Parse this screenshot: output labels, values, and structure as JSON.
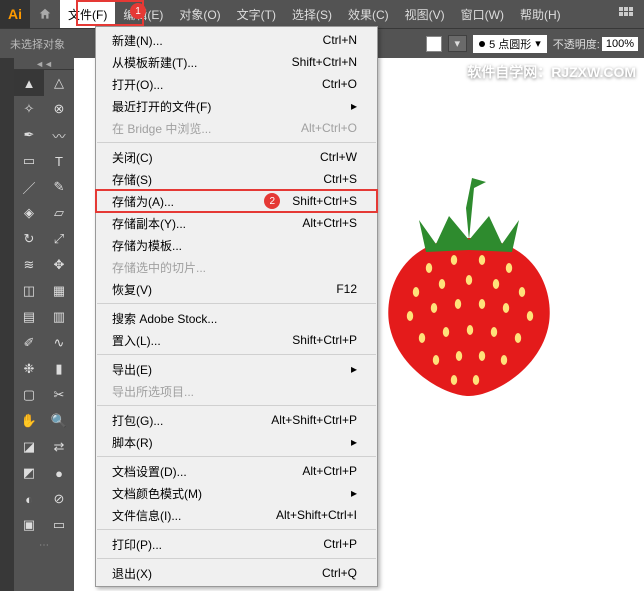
{
  "menubar": {
    "items": [
      "文件(F)",
      "编辑(E)",
      "对象(O)",
      "文字(T)",
      "选择(S)",
      "效果(C)",
      "视图(V)",
      "窗口(W)",
      "帮助(H)"
    ],
    "active_index": 0
  },
  "callouts": {
    "one": "1",
    "two": "2"
  },
  "options": {
    "noselect": "未选择对象",
    "stroke_style": "5 点圆形",
    "opacity_label": "不透明度:",
    "opacity_value": "100%"
  },
  "watermark": "软件自学网：RJZXW.COM",
  "dropdown": {
    "items": [
      {
        "label": "新建(N)...",
        "shortcut": "Ctrl+N"
      },
      {
        "label": "从模板新建(T)...",
        "shortcut": "Shift+Ctrl+N"
      },
      {
        "label": "打开(O)...",
        "shortcut": "Ctrl+O"
      },
      {
        "label": "最近打开的文件(F)",
        "submenu": true
      },
      {
        "label": "在 Bridge 中浏览...",
        "shortcut": "Alt+Ctrl+O",
        "disabled": true
      },
      {
        "sep": true
      },
      {
        "label": "关闭(C)",
        "shortcut": "Ctrl+W"
      },
      {
        "label": "存储(S)",
        "shortcut": "Ctrl+S"
      },
      {
        "label": "存储为(A)...",
        "shortcut": "Shift+Ctrl+S",
        "highlighted": true,
        "callout": true
      },
      {
        "label": "存储副本(Y)...",
        "shortcut": "Alt+Ctrl+S"
      },
      {
        "label": "存储为模板...",
        "shortcut": ""
      },
      {
        "label": "存储选中的切片...",
        "shortcut": "",
        "disabled": true
      },
      {
        "label": "恢复(V)",
        "shortcut": "F12"
      },
      {
        "sep": true
      },
      {
        "label": "搜索 Adobe Stock...",
        "shortcut": ""
      },
      {
        "label": "置入(L)...",
        "shortcut": "Shift+Ctrl+P"
      },
      {
        "sep": true
      },
      {
        "label": "导出(E)",
        "submenu": true
      },
      {
        "label": "导出所选项目...",
        "shortcut": "",
        "disabled": true
      },
      {
        "sep": true
      },
      {
        "label": "打包(G)...",
        "shortcut": "Alt+Shift+Ctrl+P"
      },
      {
        "label": "脚本(R)",
        "submenu": true
      },
      {
        "sep": true
      },
      {
        "label": "文档设置(D)...",
        "shortcut": "Alt+Ctrl+P"
      },
      {
        "label": "文档颜色模式(M)",
        "submenu": true
      },
      {
        "label": "文件信息(I)...",
        "shortcut": "Alt+Shift+Ctrl+I"
      },
      {
        "sep": true
      },
      {
        "label": "打印(P)...",
        "shortcut": "Ctrl+P"
      },
      {
        "sep": true
      },
      {
        "label": "退出(X)",
        "shortcut": "Ctrl+Q"
      }
    ]
  },
  "tools": [
    "selection",
    "direct-selection",
    "magic-wand",
    "lasso",
    "pen",
    "curvature",
    "rectangle",
    "type",
    "line",
    "paintbrush",
    "shaper",
    "eraser",
    "rotate",
    "scale",
    "width",
    "free-transform",
    "shape-builder",
    "perspective-grid",
    "mesh",
    "gradient",
    "eyedropper",
    "blend",
    "symbol-sprayer",
    "column-graph",
    "artboard",
    "slice",
    "hand",
    "zoom",
    "fill-stroke",
    "swap",
    "default-fs",
    "color",
    "gradient-mode",
    "none",
    "screen-mode",
    "change-screen"
  ]
}
